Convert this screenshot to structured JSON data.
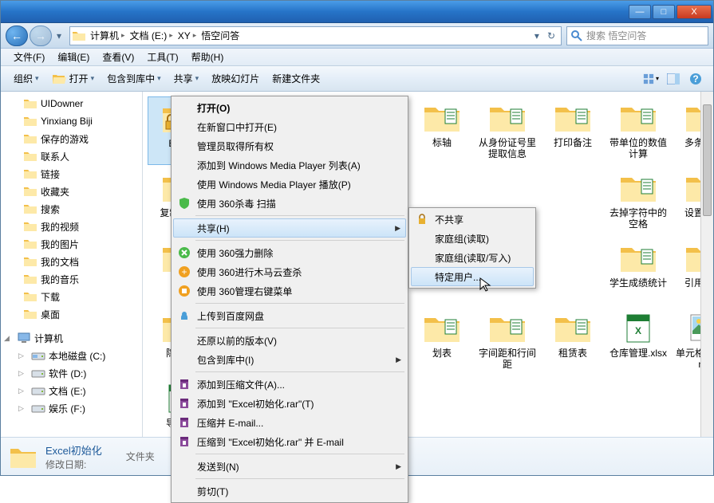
{
  "titlebar": {
    "min": "—",
    "max": "□",
    "close": "X"
  },
  "nav": {
    "back": "←",
    "fwd": "→"
  },
  "breadcrumbs": [
    "计算机",
    "文档 (E:)",
    "XY",
    "悟空问答"
  ],
  "search_placeholder": "搜索 悟空问答",
  "menubar": [
    "文件(F)",
    "编辑(E)",
    "查看(V)",
    "工具(T)",
    "帮助(H)"
  ],
  "toolbar": {
    "organize": "组织",
    "open": "打开",
    "include": "包含到库中",
    "share": "共享",
    "slideshow": "放映幻灯片",
    "newfolder": "新建文件夹"
  },
  "sidebar": [
    {
      "label": "UIDowner",
      "icon": "folder"
    },
    {
      "label": "Yinxiang Biji",
      "icon": "folder"
    },
    {
      "label": "保存的游戏",
      "icon": "folder-saved"
    },
    {
      "label": "联系人",
      "icon": "contacts"
    },
    {
      "label": "链接",
      "icon": "links"
    },
    {
      "label": "收藏夹",
      "icon": "favorites"
    },
    {
      "label": "搜索",
      "icon": "search"
    },
    {
      "label": "我的视频",
      "icon": "videos"
    },
    {
      "label": "我的图片",
      "icon": "pictures"
    },
    {
      "label": "我的文档",
      "icon": "documents"
    },
    {
      "label": "我的音乐",
      "icon": "music"
    },
    {
      "label": "下载",
      "icon": "downloads"
    },
    {
      "label": "桌面",
      "icon": "desktop"
    }
  ],
  "sidebar_computer": {
    "label": "计算机",
    "drives": [
      {
        "label": "本地磁盘 (C:)",
        "icon": "drive-sys"
      },
      {
        "label": "软件 (D:)",
        "icon": "drive"
      },
      {
        "label": "文档 (E:)",
        "icon": "drive"
      },
      {
        "label": "娱乐 (F:)",
        "icon": "drive"
      }
    ]
  },
  "files": [
    {
      "name": "Excel",
      "selected": true,
      "icon": "folder-lock"
    },
    {
      "name": "标轴",
      "icon": "folder-doc"
    },
    {
      "name": "从身份证号里提取信息",
      "icon": "folder-doc"
    },
    {
      "name": "打印备注",
      "icon": "folder-doc"
    },
    {
      "name": "带单位的数值计算",
      "icon": "folder-doc"
    },
    {
      "name": "多条查询",
      "icon": "folder-doc"
    },
    {
      "name": "复制\n的数",
      "icon": "folder-doc"
    },
    {
      "name": "去掉字符中的空格",
      "icon": "folder-doc"
    },
    {
      "name": "设置密码",
      "icon": "folder-doc"
    },
    {
      "name": "设置",
      "icon": "folder-doc"
    },
    {
      "name": "学生成绩统计",
      "icon": "folder-doc"
    },
    {
      "name": "引用符号",
      "icon": "folder-doc"
    },
    {
      "name": "隐藏数",
      "icon": "folder-doc"
    },
    {
      "name": "划表",
      "icon": "folder-doc"
    },
    {
      "name": "字间距和行间距",
      "icon": "folder-doc"
    },
    {
      "name": "租赁表",
      "icon": "folder-doc"
    },
    {
      "name": "仓库管理.xlsx",
      "icon": "xlsx"
    },
    {
      "name": "单元格匹配.png",
      "icon": "png"
    },
    {
      "name": "导入文",
      "icon": "xlsx"
    }
  ],
  "context_menu": [
    {
      "label": "打开(O)",
      "bold": true
    },
    {
      "label": "在新窗口中打开(E)"
    },
    {
      "label": "管理员取得所有权"
    },
    {
      "label": "添加到 Windows Media Player 列表(A)"
    },
    {
      "label": "使用 Windows Media Player 播放(P)"
    },
    {
      "label": "使用 360杀毒 扫描",
      "icon": "shield"
    },
    {
      "sep": true
    },
    {
      "label": "共享(H)",
      "submenu": true,
      "hover": true
    },
    {
      "sep": true
    },
    {
      "label": "使用 360强力删除",
      "icon": "360del"
    },
    {
      "label": "使用 360进行木马云查杀",
      "icon": "360scan"
    },
    {
      "label": "使用 360管理右键菜单",
      "icon": "360menu"
    },
    {
      "sep": true
    },
    {
      "label": "上传到百度网盘",
      "icon": "baidu"
    },
    {
      "sep": true
    },
    {
      "label": "还原以前的版本(V)"
    },
    {
      "label": "包含到库中(I)",
      "submenu": true
    },
    {
      "sep": true
    },
    {
      "label": "添加到压缩文件(A)...",
      "icon": "rar"
    },
    {
      "label": "添加到 \"Excel初始化.rar\"(T)",
      "icon": "rar"
    },
    {
      "label": "压缩并 E-mail...",
      "icon": "rar"
    },
    {
      "label": "压缩到 \"Excel初始化.rar\" 并 E-mail",
      "icon": "rar"
    },
    {
      "sep": true
    },
    {
      "label": "发送到(N)",
      "submenu": true
    },
    {
      "sep": true
    },
    {
      "label": "剪切(T)"
    }
  ],
  "share_submenu": [
    {
      "label": "不共享",
      "icon": "lock"
    },
    {
      "label": "家庭组(读取)"
    },
    {
      "label": "家庭组(读取/写入)"
    },
    {
      "label": "特定用户...",
      "hover": true
    }
  ],
  "details": {
    "name": "Excel初始化",
    "meta": "修改日期:",
    "type": "文件夹"
  }
}
